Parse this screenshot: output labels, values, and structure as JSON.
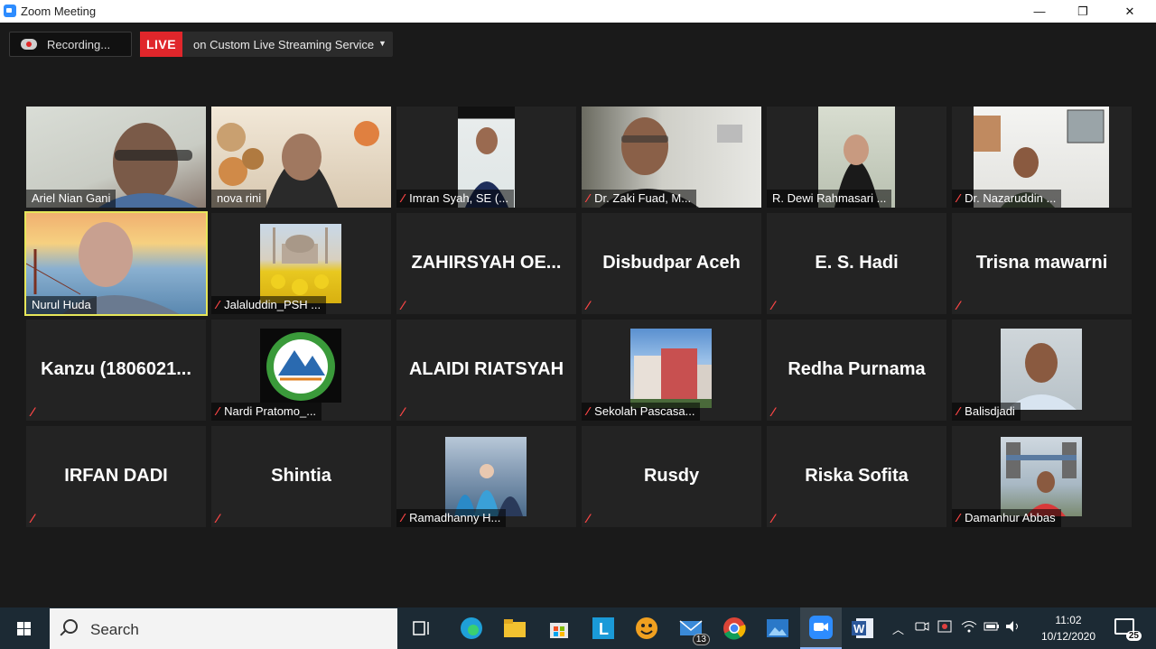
{
  "window": {
    "title": "Zoom Meeting",
    "minimize": "—",
    "maximize": "❐",
    "close": "✕"
  },
  "recording": {
    "label": "Recording..."
  },
  "live": {
    "tag": "LIVE",
    "service": "on Custom Live Streaming Service",
    "caret": "▼"
  },
  "mute_glyph": "🎙̸",
  "participants": [
    {
      "name": "Ariel Nian Gani",
      "video": true,
      "muted": false
    },
    {
      "name": "nova rini",
      "video": true,
      "muted": false
    },
    {
      "name": "Imran Syah, SE (...",
      "video": true,
      "muted": true
    },
    {
      "name": "Dr. Zaki Fuad, M...",
      "video": true,
      "muted": true
    },
    {
      "name": "R. Dewi Rahmasari ...",
      "video": true,
      "muted": false
    },
    {
      "name": "Dr. Nazaruddin ...",
      "video": true,
      "muted": true
    },
    {
      "name": "Nurul Huda",
      "video": true,
      "muted": false,
      "active": true
    },
    {
      "name": "Jalaluddin_PSH ...",
      "video": true,
      "muted": true
    },
    {
      "name": "ZAHIRSYAH OE...",
      "video": false,
      "muted": true
    },
    {
      "name": "Disbudpar Aceh",
      "video": false,
      "muted": true
    },
    {
      "name": "E. S. Hadi",
      "video": false,
      "muted": true
    },
    {
      "name": "Trisna mawarni",
      "video": false,
      "muted": true
    },
    {
      "name": "Kanzu  (1806021...",
      "video": false,
      "muted": true
    },
    {
      "name": "Nardi Pratomo_...",
      "video": true,
      "muted": true
    },
    {
      "name": "ALAIDI RIATSYAH",
      "video": false,
      "muted": true
    },
    {
      "name": "Sekolah Pascasa...",
      "video": true,
      "muted": true
    },
    {
      "name": "Redha Purnama",
      "video": false,
      "muted": true
    },
    {
      "name": "Balisdjadi",
      "video": true,
      "muted": true
    },
    {
      "name": "IRFAN DADI",
      "video": false,
      "muted": true
    },
    {
      "name": "Shintia",
      "video": false,
      "muted": true
    },
    {
      "name": "Ramadhanny H...",
      "video": true,
      "muted": true
    },
    {
      "name": "Rusdy",
      "video": false,
      "muted": true
    },
    {
      "name": "Riska Sofita",
      "video": false,
      "muted": true
    },
    {
      "name": "Damanhur Abbas",
      "video": true,
      "muted": true
    }
  ],
  "taskbar": {
    "search_label": "Search",
    "mail_badge": "13",
    "time": "11:02",
    "date": "10/12/2020",
    "notifications": "25"
  }
}
